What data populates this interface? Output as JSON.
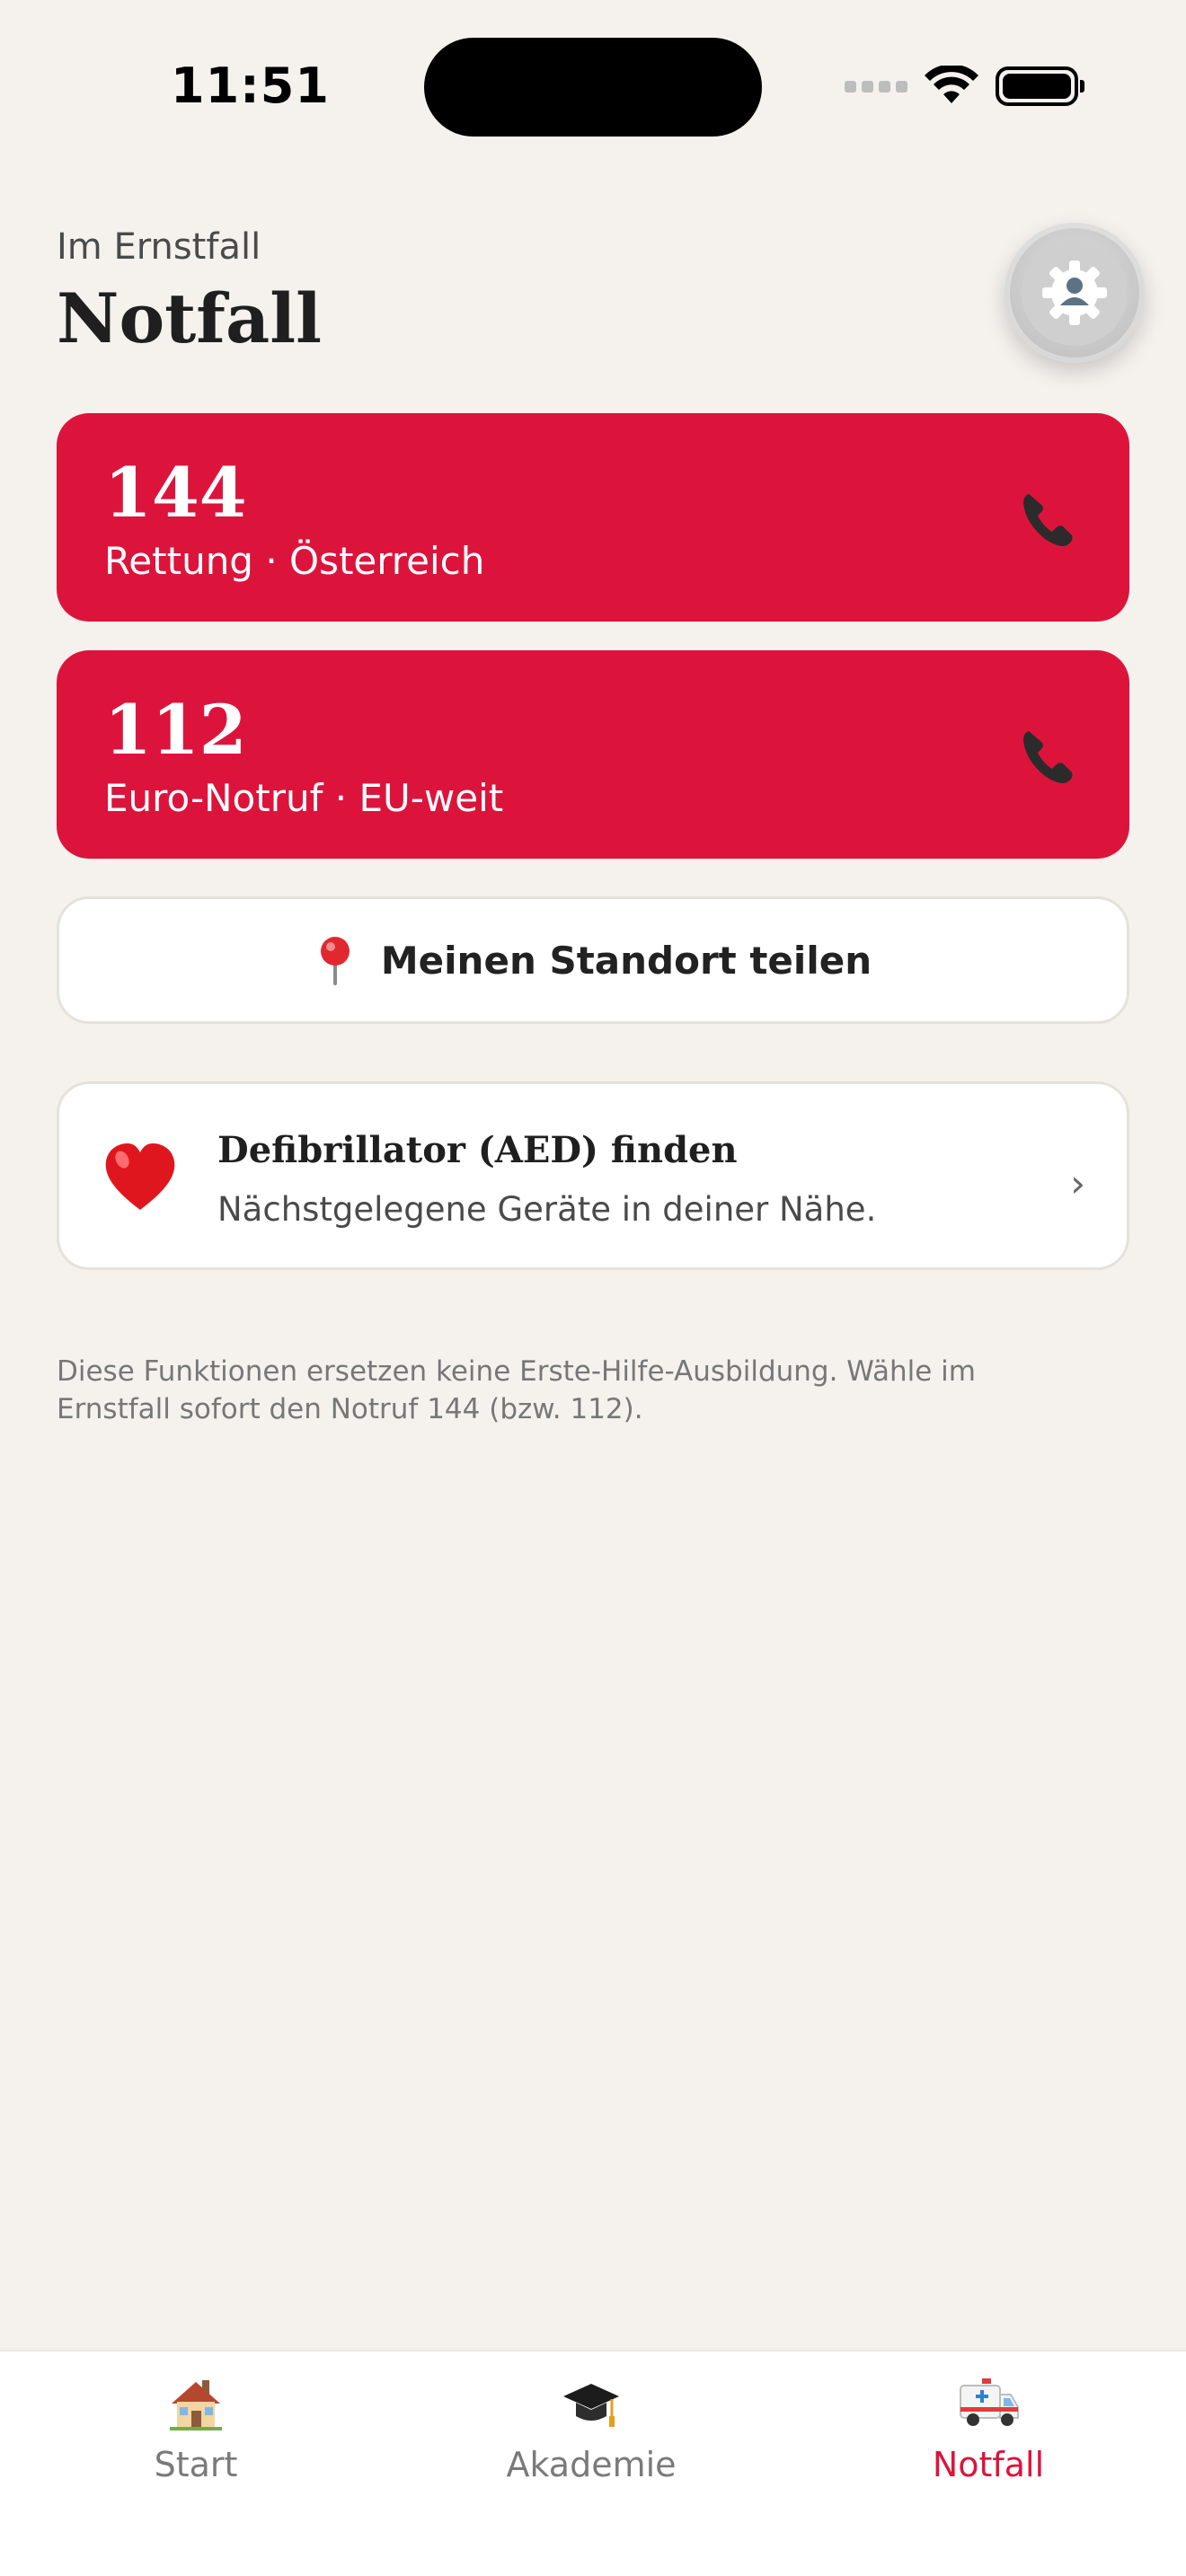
{
  "status_bar": {
    "time": "11:51"
  },
  "header": {
    "kicker": "Im Ernstfall",
    "title": "Notfall",
    "settings_icon": "gear-icon"
  },
  "emergency_calls": [
    {
      "number": "144",
      "label": "Rettung · Österreich",
      "icon": "phone-icon"
    },
    {
      "number": "112",
      "label": "Euro-Notruf · EU-weit",
      "icon": "phone-icon"
    }
  ],
  "location": {
    "label": "Meinen Standort teilen",
    "icon": "pin-icon"
  },
  "aed": {
    "title": "Defibrillator (AED) finden",
    "description": "Nächstgelegene Geräte in deiner Nähe.",
    "icon": "heart-icon",
    "chevron": "›"
  },
  "disclaimer": "Diese Funktionen ersetzen keine Erste-Hilfe-Ausbildung. Wähle im Ernstfall sofort den Notruf 144 (bzw. 112).",
  "tabbar": {
    "tabs": [
      {
        "label": "Start",
        "icon": "house-icon",
        "active": false
      },
      {
        "label": "Akademie",
        "icon": "graduation-cap-icon",
        "active": false
      },
      {
        "label": "Notfall",
        "icon": "ambulance-icon",
        "active": true
      }
    ]
  },
  "colors": {
    "accent": "#DC143C",
    "background": "#F5F2EE",
    "card": "#FFFFFF"
  }
}
